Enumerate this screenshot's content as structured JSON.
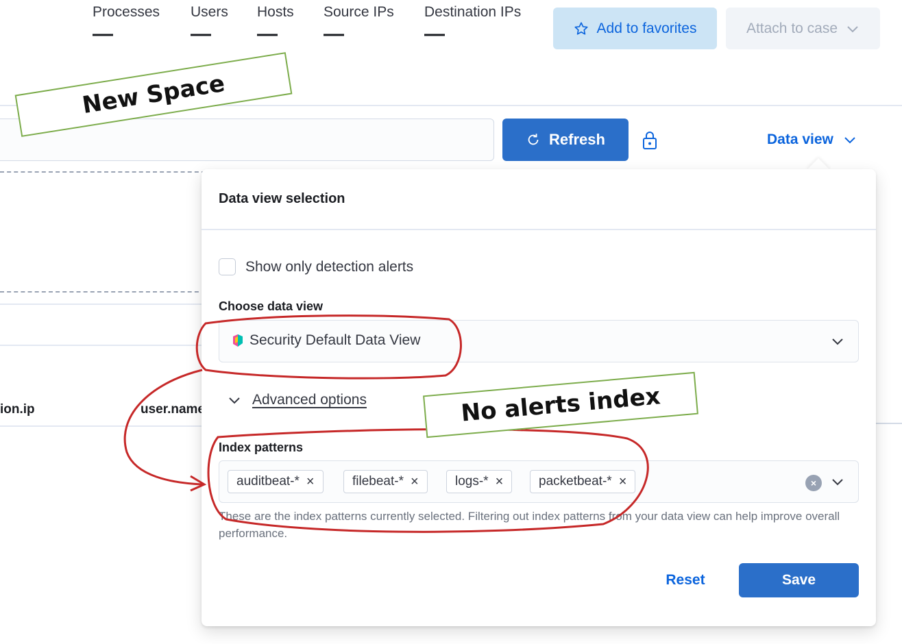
{
  "stats": [
    {
      "label": "Processes",
      "value": "—"
    },
    {
      "label": "Users",
      "value": "—"
    },
    {
      "label": "Hosts",
      "value": "—"
    },
    {
      "label": "Source IPs",
      "value": "—"
    },
    {
      "label": "Destination IPs",
      "value": "—"
    }
  ],
  "header": {
    "favorites_label": "Add to favorites",
    "attach_label": "Attach to case"
  },
  "toolbar": {
    "refresh_label": "Refresh",
    "data_view_label": "Data view"
  },
  "table": {
    "columns": [
      "ion.ip",
      "user.name"
    ]
  },
  "popover": {
    "title": "Data view selection",
    "checkbox_label": "Show only detection alerts",
    "choose_label": "Choose data view",
    "selected_data_view": "Security Default Data View",
    "advanced_label": "Advanced options",
    "index_label": "Index patterns",
    "index_patterns": [
      "auditbeat-*",
      "filebeat-*",
      "logs-*",
      "packetbeat-*"
    ],
    "help_text": "These are the index patterns currently selected. Filtering out index patterns from your data view can help improve overall performance.",
    "reset_label": "Reset",
    "save_label": "Save"
  },
  "annotations": {
    "space_note": "New Space",
    "alerts_note": "No alerts index",
    "outline_color": "#c62828",
    "note_border_color": "#7cac4b"
  },
  "colors": {
    "primary": "#2b6fc9",
    "link": "#0b64dd",
    "favorites_bg": "#cce4f5"
  }
}
